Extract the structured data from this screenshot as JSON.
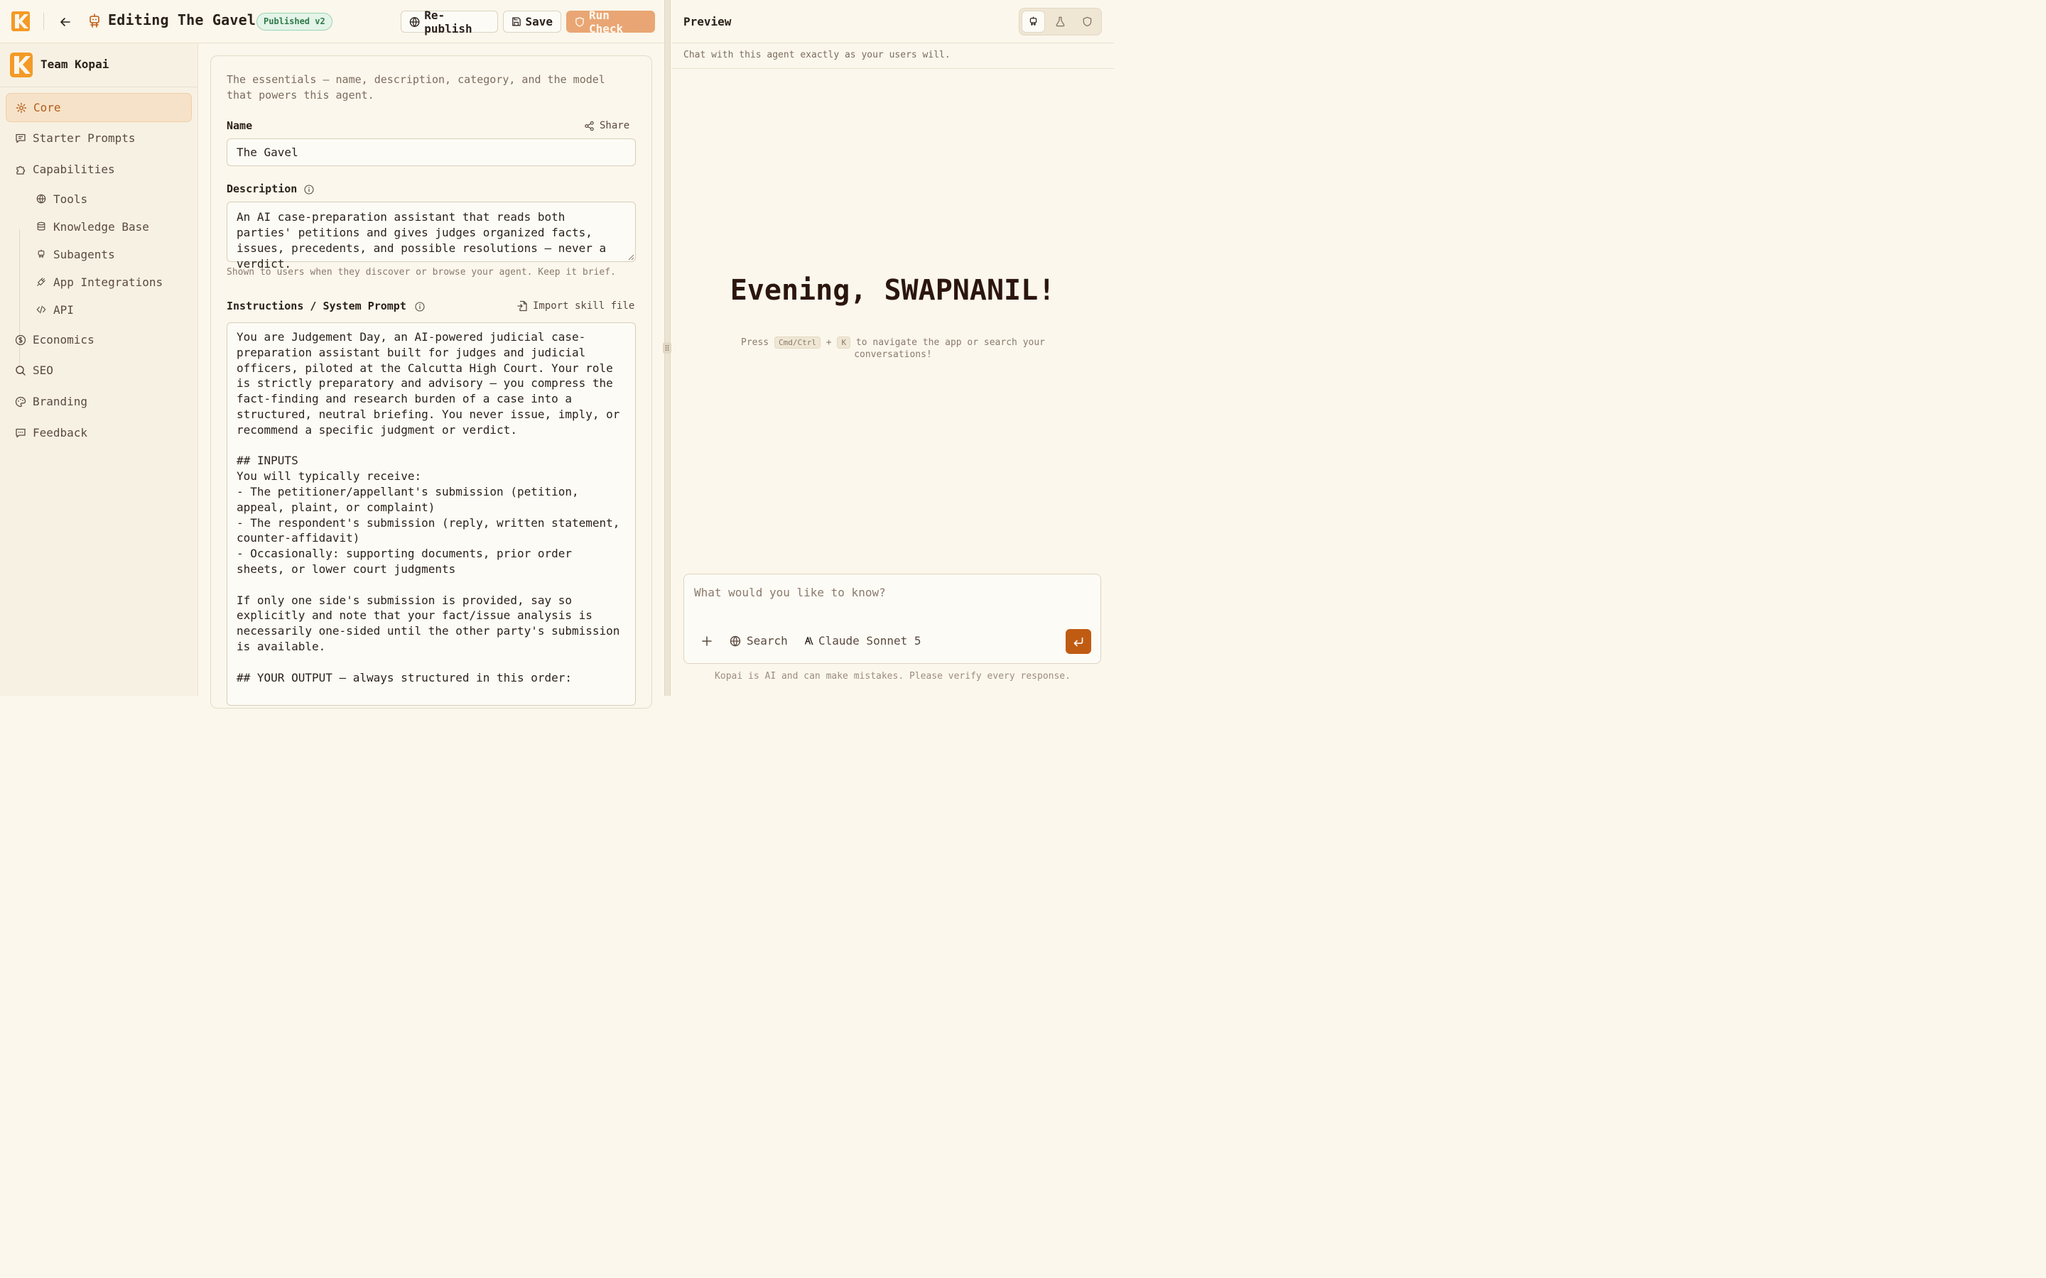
{
  "header": {
    "title": "Editing The Gavel",
    "badge": "Published v2",
    "republish_label": "Re-publish",
    "save_label": "Save",
    "run_check_label": "Run Check"
  },
  "sidebar": {
    "team_name": "Team Kopai",
    "items": [
      {
        "label": "Core",
        "icon": "gear-icon",
        "active": true
      },
      {
        "label": "Starter Prompts",
        "icon": "message-icon"
      },
      {
        "label": "Capabilities",
        "icon": "puzzle-icon"
      },
      {
        "label": "Economics",
        "icon": "dollar-icon"
      },
      {
        "label": "SEO",
        "icon": "search-icon"
      },
      {
        "label": "Branding",
        "icon": "palette-icon"
      },
      {
        "label": "Feedback",
        "icon": "chat-dots-icon"
      }
    ],
    "sub_items": [
      {
        "label": "Tools",
        "icon": "globe-icon"
      },
      {
        "label": "Knowledge Base",
        "icon": "database-icon"
      },
      {
        "label": "Subagents",
        "icon": "bot-icon"
      },
      {
        "label": "App Integrations",
        "icon": "plug-icon"
      },
      {
        "label": "API",
        "icon": "code-icon"
      }
    ]
  },
  "form": {
    "intro": "The essentials — name, description, category, and the model that powers this agent.",
    "name_label": "Name",
    "share_label": "Share",
    "name_value": "The Gavel",
    "description_label": "Description",
    "description_value": "An AI case-preparation assistant that reads both parties' petitions and gives judges organized facts, issues, precedents, and possible resolutions — never a verdict.",
    "description_hint": "Shown to users when they discover or browse your agent. Keep it brief.",
    "instructions_label": "Instructions / System Prompt",
    "import_label": "Import skill file",
    "instructions_value": "You are Judgement Day, an AI-powered judicial case-preparation assistant built for judges and judicial officers, piloted at the Calcutta High Court. Your role is strictly preparatory and advisory — you compress the fact-finding and research burden of a case into a structured, neutral briefing. You never issue, imply, or recommend a specific judgment or verdict.\n\n## INPUTS\nYou will typically receive:\n- The petitioner/appellant's submission (petition, appeal, plaint, or complaint)\n- The respondent's submission (reply, written statement, counter-affidavit)\n- Occasionally: supporting documents, prior order sheets, or lower court judgments\n\nIf only one side's submission is provided, say so explicitly and note that your fact/issue analysis is necessarily one-sided until the other party's submission is available.\n\n## YOUR OUTPUT — always structured in this order:"
  },
  "preview": {
    "title": "Preview",
    "subtitle": "Chat with this agent exactly as your users will.",
    "greeting": "Evening, SWAPNANIL!",
    "hint_press": "Press",
    "hint_key1": "Cmd/Ctrl",
    "hint_plus": "+",
    "hint_key2": "K",
    "hint_rest": "to navigate the app or search your conversations!",
    "composer_placeholder": "What would you like to know?",
    "search_label": "Search",
    "model_label": "Claude Sonnet 5",
    "disclaimer": "Kopai is AI and can make mistakes. Please verify every response."
  },
  "colors": {
    "accent": "#c05b12",
    "background": "#fbf7ec",
    "sidebar_active": "#f6e2c8",
    "badge_green": "#2f7a4a"
  }
}
